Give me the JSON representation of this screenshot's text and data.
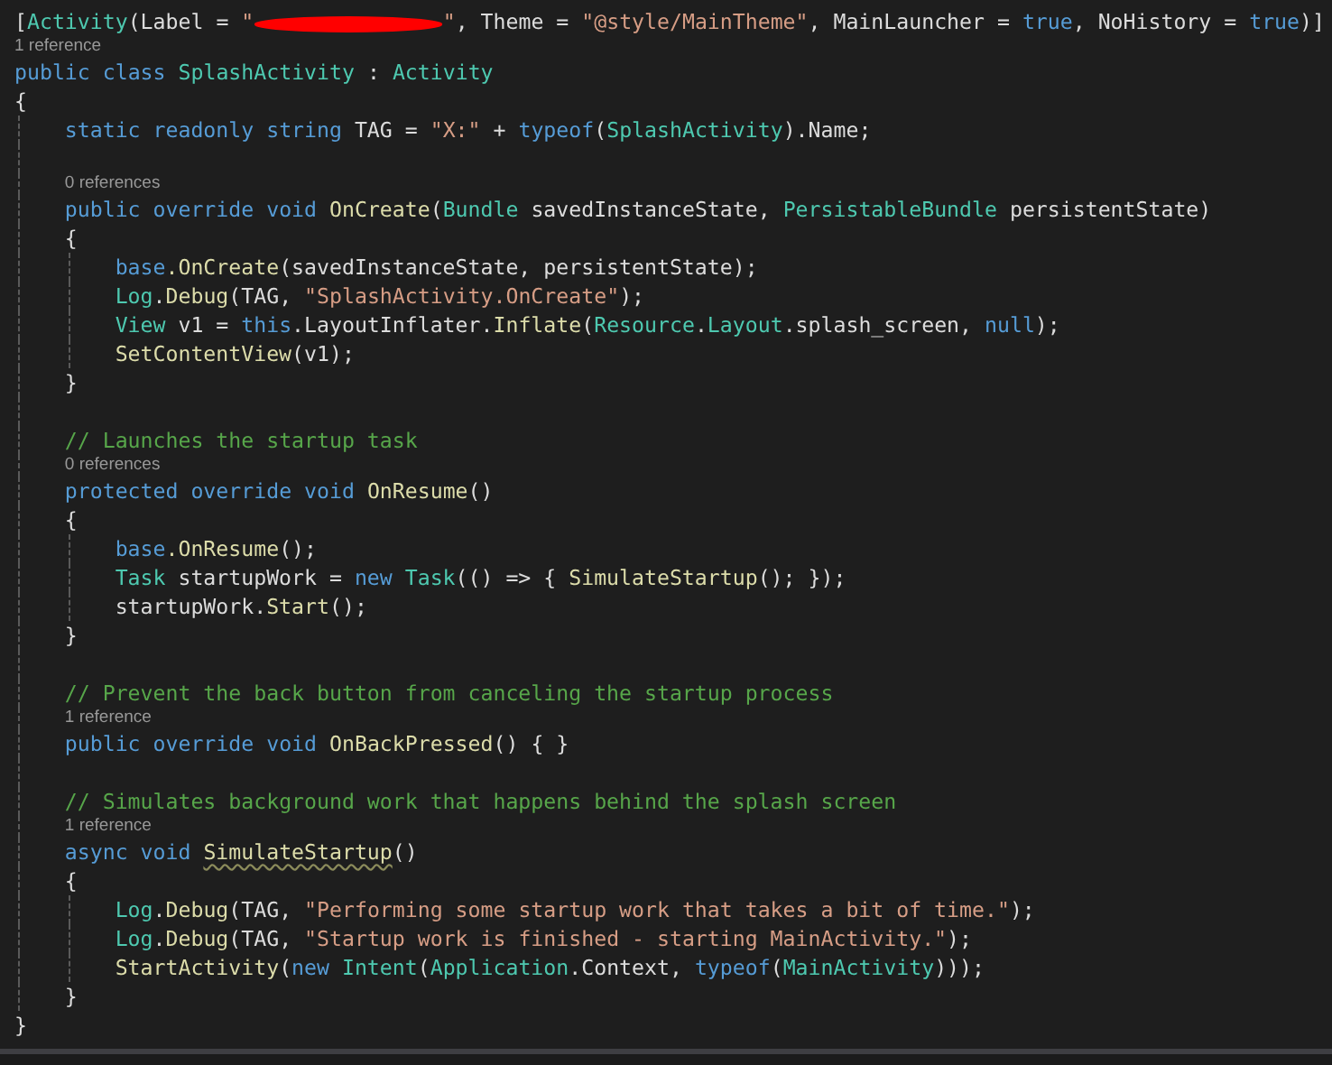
{
  "editor": {
    "lines": [
      {
        "kind": "code",
        "tokens": [
          {
            "kind": "plain",
            "text": "["
          },
          {
            "kind": "type",
            "text": "Activity"
          },
          {
            "kind": "plain",
            "text": "(Label = "
          },
          {
            "kind": "string",
            "text": "\""
          },
          {
            "kind": "redaction"
          },
          {
            "kind": "string",
            "text": "\""
          },
          {
            "kind": "plain",
            "text": ", Theme = "
          },
          {
            "kind": "string",
            "text": "\"@style/MainTheme\""
          },
          {
            "kind": "plain",
            "text": ", MainLauncher = "
          },
          {
            "kind": "keyword",
            "text": "true"
          },
          {
            "kind": "plain",
            "text": ", NoHistory = "
          },
          {
            "kind": "keyword",
            "text": "true"
          },
          {
            "kind": "plain",
            "text": ")]"
          }
        ]
      },
      {
        "kind": "lens",
        "text": "1 reference"
      },
      {
        "kind": "code",
        "tokens": [
          {
            "kind": "keyword",
            "text": "public class "
          },
          {
            "kind": "type",
            "text": "SplashActivity"
          },
          {
            "kind": "plain",
            "text": " : "
          },
          {
            "kind": "type",
            "text": "Activity"
          }
        ]
      },
      {
        "kind": "code",
        "tokens": [
          {
            "kind": "plain",
            "text": "{"
          }
        ]
      },
      {
        "kind": "code",
        "tokens": [
          {
            "kind": "keyword",
            "text": "    static readonly string"
          },
          {
            "kind": "plain",
            "text": " TAG = "
          },
          {
            "kind": "string",
            "text": "\"X:\""
          },
          {
            "kind": "plain",
            "text": " + "
          },
          {
            "kind": "keyword",
            "text": "typeof"
          },
          {
            "kind": "plain",
            "text": "("
          },
          {
            "kind": "type",
            "text": "SplashActivity"
          },
          {
            "kind": "plain",
            "text": ").Name;"
          }
        ]
      },
      {
        "kind": "blank"
      },
      {
        "kind": "lens",
        "text": "0 references"
      },
      {
        "kind": "code",
        "tokens": [
          {
            "kind": "keyword",
            "text": "    public override void "
          },
          {
            "kind": "method",
            "text": "OnCreate"
          },
          {
            "kind": "plain",
            "text": "("
          },
          {
            "kind": "type",
            "text": "Bundle"
          },
          {
            "kind": "plain",
            "text": " savedInstanceState, "
          },
          {
            "kind": "type",
            "text": "PersistableBundle"
          },
          {
            "kind": "plain",
            "text": " persistentState)"
          }
        ]
      },
      {
        "kind": "code",
        "tokens": [
          {
            "kind": "plain",
            "text": "    {"
          }
        ]
      },
      {
        "kind": "code",
        "tokens": [
          {
            "kind": "keyword",
            "text": "        base"
          },
          {
            "kind": "method",
            "text": ".OnCreate"
          },
          {
            "kind": "plain",
            "text": "(savedInstanceState, persistentState);"
          }
        ]
      },
      {
        "kind": "code",
        "tokens": [
          {
            "kind": "type",
            "text": "        Log"
          },
          {
            "kind": "plain",
            "text": "."
          },
          {
            "kind": "method",
            "text": "Debug"
          },
          {
            "kind": "plain",
            "text": "(TAG, "
          },
          {
            "kind": "string",
            "text": "\"SplashActivity.OnCreate\""
          },
          {
            "kind": "plain",
            "text": ");"
          }
        ]
      },
      {
        "kind": "code",
        "tokens": [
          {
            "kind": "type",
            "text": "        View"
          },
          {
            "kind": "plain",
            "text": " v1 = "
          },
          {
            "kind": "keyword",
            "text": "this"
          },
          {
            "kind": "plain",
            "text": ".LayoutInflater."
          },
          {
            "kind": "method",
            "text": "Inflate"
          },
          {
            "kind": "plain",
            "text": "("
          },
          {
            "kind": "type",
            "text": "Resource"
          },
          {
            "kind": "plain",
            "text": "."
          },
          {
            "kind": "type",
            "text": "Layout"
          },
          {
            "kind": "plain",
            "text": ".splash_screen, "
          },
          {
            "kind": "keyword",
            "text": "null"
          },
          {
            "kind": "plain",
            "text": ");"
          }
        ]
      },
      {
        "kind": "code",
        "tokens": [
          {
            "kind": "method",
            "text": "        SetContentView"
          },
          {
            "kind": "plain",
            "text": "(v1);"
          }
        ]
      },
      {
        "kind": "code",
        "tokens": [
          {
            "kind": "plain",
            "text": "    }"
          }
        ]
      },
      {
        "kind": "blank"
      },
      {
        "kind": "code",
        "tokens": [
          {
            "kind": "comment",
            "text": "    // Launches the startup task"
          }
        ]
      },
      {
        "kind": "lens",
        "text": "0 references"
      },
      {
        "kind": "code",
        "tokens": [
          {
            "kind": "keyword",
            "text": "    protected override void "
          },
          {
            "kind": "method",
            "text": "OnResume"
          },
          {
            "kind": "plain",
            "text": "()"
          }
        ]
      },
      {
        "kind": "code",
        "tokens": [
          {
            "kind": "plain",
            "text": "    {"
          }
        ]
      },
      {
        "kind": "code",
        "tokens": [
          {
            "kind": "keyword",
            "text": "        base"
          },
          {
            "kind": "method",
            "text": ".OnResume"
          },
          {
            "kind": "plain",
            "text": "();"
          }
        ]
      },
      {
        "kind": "code",
        "tokens": [
          {
            "kind": "type",
            "text": "        Task"
          },
          {
            "kind": "plain",
            "text": " startupWork = "
          },
          {
            "kind": "keyword",
            "text": "new "
          },
          {
            "kind": "type",
            "text": "Task"
          },
          {
            "kind": "plain",
            "text": "(() => { "
          },
          {
            "kind": "method",
            "text": "SimulateStartup"
          },
          {
            "kind": "plain",
            "text": "(); });"
          }
        ]
      },
      {
        "kind": "code",
        "tokens": [
          {
            "kind": "plain",
            "text": "        startupWork."
          },
          {
            "kind": "method",
            "text": "Start"
          },
          {
            "kind": "plain",
            "text": "();"
          }
        ]
      },
      {
        "kind": "code",
        "tokens": [
          {
            "kind": "plain",
            "text": "    }"
          }
        ]
      },
      {
        "kind": "blank"
      },
      {
        "kind": "code",
        "tokens": [
          {
            "kind": "comment",
            "text": "    // Prevent the back button from canceling the startup process"
          }
        ]
      },
      {
        "kind": "lens",
        "text": "1 reference"
      },
      {
        "kind": "code",
        "tokens": [
          {
            "kind": "keyword",
            "text": "    public override void "
          },
          {
            "kind": "method",
            "text": "OnBackPressed"
          },
          {
            "kind": "plain",
            "text": "() { }"
          }
        ]
      },
      {
        "kind": "blank"
      },
      {
        "kind": "code",
        "tokens": [
          {
            "kind": "comment",
            "text": "    // Simulates background work that happens behind the splash screen"
          }
        ]
      },
      {
        "kind": "lens",
        "text": "1 reference"
      },
      {
        "kind": "code",
        "tokens": [
          {
            "kind": "keyword",
            "text": "    async void "
          },
          {
            "kind": "method",
            "text": "SimulateStartup",
            "squiggle": true
          },
          {
            "kind": "plain",
            "text": "()"
          }
        ]
      },
      {
        "kind": "code",
        "tokens": [
          {
            "kind": "plain",
            "text": "    {"
          }
        ]
      },
      {
        "kind": "code",
        "tokens": [
          {
            "kind": "type",
            "text": "        Log"
          },
          {
            "kind": "plain",
            "text": "."
          },
          {
            "kind": "method",
            "text": "Debug"
          },
          {
            "kind": "plain",
            "text": "(TAG, "
          },
          {
            "kind": "string",
            "text": "\"Performing some startup work that takes a bit of time.\""
          },
          {
            "kind": "plain",
            "text": ");"
          }
        ]
      },
      {
        "kind": "code",
        "tokens": [
          {
            "kind": "type",
            "text": "        Log"
          },
          {
            "kind": "plain",
            "text": "."
          },
          {
            "kind": "method",
            "text": "Debug"
          },
          {
            "kind": "plain",
            "text": "(TAG, "
          },
          {
            "kind": "string",
            "text": "\"Startup work is finished - starting MainActivity.\""
          },
          {
            "kind": "plain",
            "text": ");"
          }
        ]
      },
      {
        "kind": "code",
        "tokens": [
          {
            "kind": "method",
            "text": "        StartActivity"
          },
          {
            "kind": "plain",
            "text": "("
          },
          {
            "kind": "keyword",
            "text": "new "
          },
          {
            "kind": "type",
            "text": "Intent"
          },
          {
            "kind": "plain",
            "text": "("
          },
          {
            "kind": "type",
            "text": "Application"
          },
          {
            "kind": "plain",
            "text": ".Context, "
          },
          {
            "kind": "keyword",
            "text": "typeof"
          },
          {
            "kind": "plain",
            "text": "("
          },
          {
            "kind": "type",
            "text": "MainActivity"
          },
          {
            "kind": "plain",
            "text": ")));"
          }
        ]
      },
      {
        "kind": "code",
        "tokens": [
          {
            "kind": "plain",
            "text": "    }"
          }
        ]
      },
      {
        "kind": "code",
        "tokens": [
          {
            "kind": "plain",
            "text": "}"
          }
        ]
      }
    ]
  }
}
